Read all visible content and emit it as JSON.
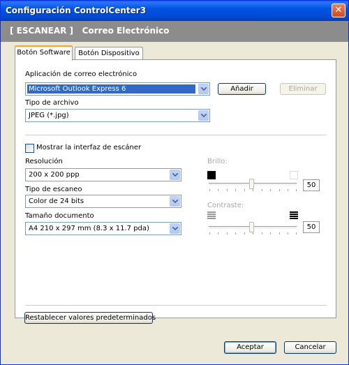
{
  "window": {
    "title": "Configuración ControlCenter3",
    "close_glyph": "✕"
  },
  "header": {
    "section": "[ ESCANEAR ]",
    "subsection": "Correo Electrónico"
  },
  "tabs": [
    {
      "label": "Botón Software",
      "active": true
    },
    {
      "label": "Botón Dispositivo",
      "active": false
    }
  ],
  "email_app": {
    "label": "Aplicación de correo electrónico",
    "value": "Microsoft Outlook Express 6",
    "add_button": "Añadir",
    "remove_button": "Eliminar"
  },
  "file_type": {
    "label": "Tipo de archivo",
    "value": "JPEG (*.jpg)"
  },
  "show_scanner_ui": {
    "label": "Mostrar la interfaz de escáner",
    "checked": false
  },
  "resolution": {
    "label": "Resolución",
    "value": "200 x 200 ppp"
  },
  "scan_type": {
    "label": "Tipo de escaneo",
    "value": "Color de 24 bits"
  },
  "doc_size": {
    "label": "Tamaño documento",
    "value": "A4 210 x 297 mm (8.3 x 11.7 pda)"
  },
  "brightness": {
    "label": "Brillo:",
    "value": "50"
  },
  "contrast": {
    "label": "Contraste:",
    "value": "50"
  },
  "restore_defaults_button": "Restablecer valores predeterminados",
  "footer": {
    "accept_button": "Aceptar",
    "cancel_button": "Cancelar"
  },
  "icons": [
    "close-icon",
    "chevron-down-icon",
    "brightness-dark-icon",
    "brightness-light-icon",
    "contrast-low-icon",
    "contrast-high-icon"
  ]
}
